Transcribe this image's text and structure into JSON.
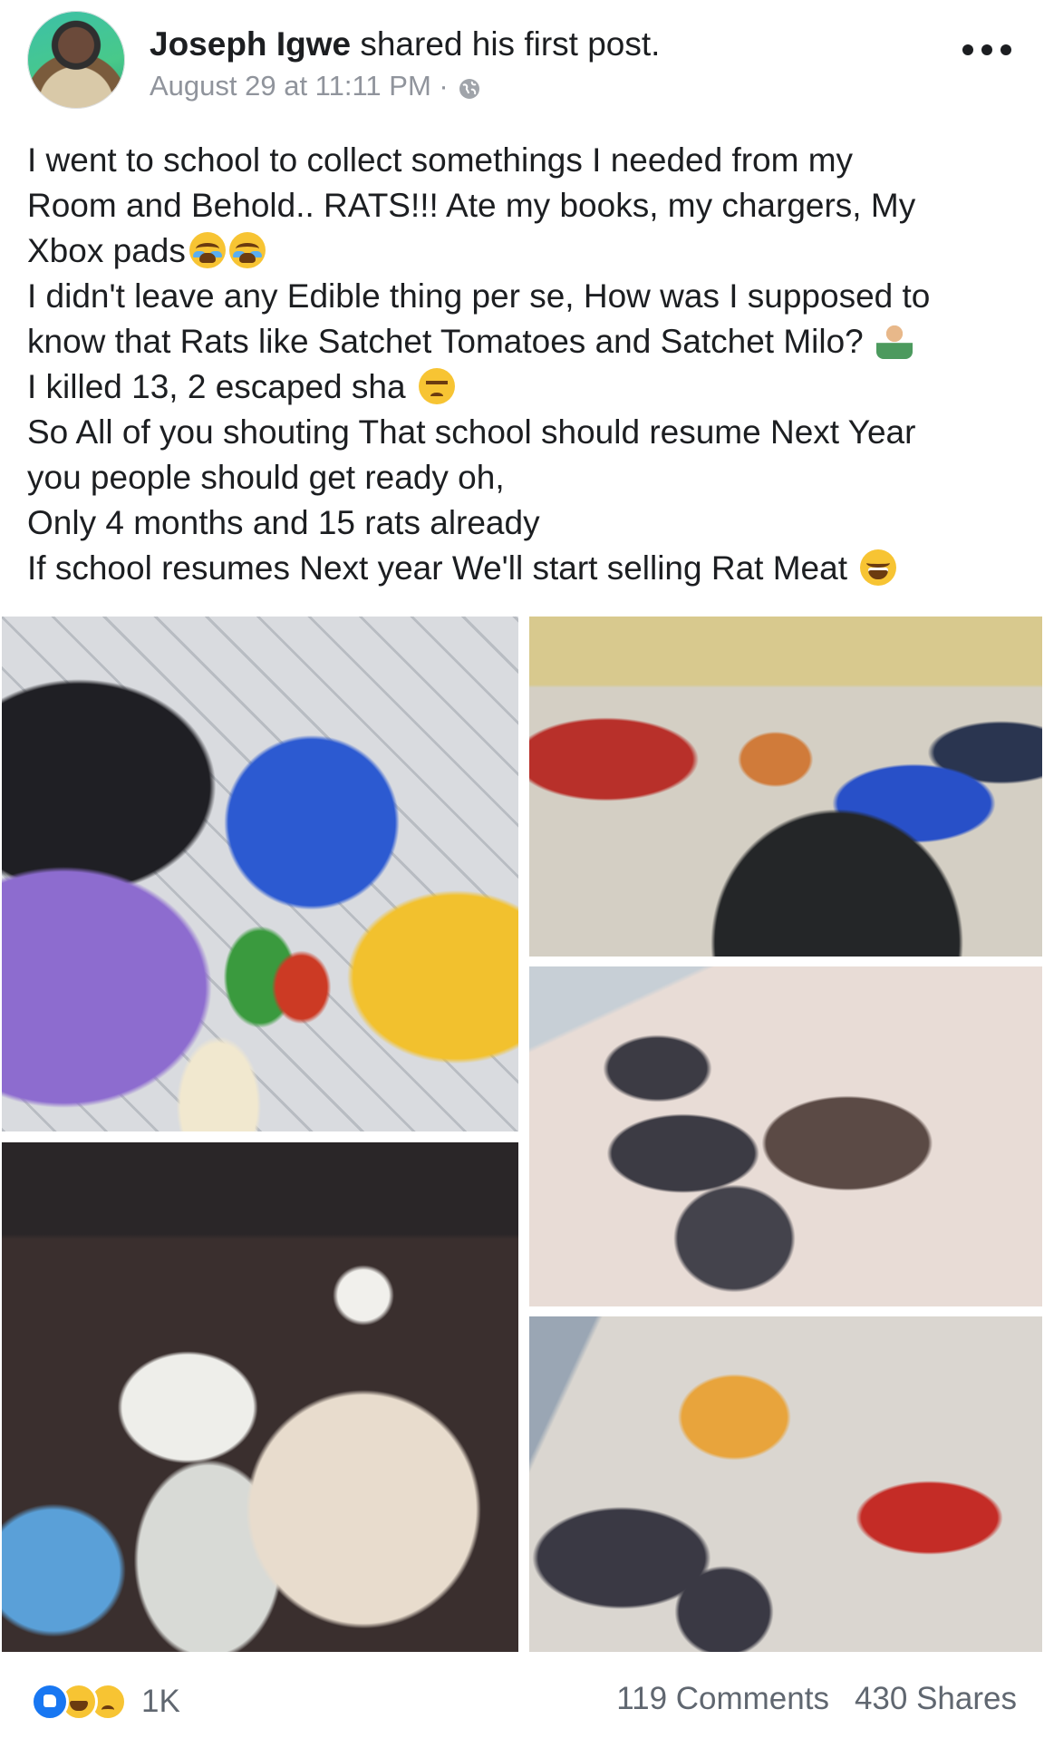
{
  "post": {
    "author": "Joseph Igwe",
    "action": "shared his first post.",
    "date": "August 29 at 11:11 PM",
    "separator": "·",
    "privacy_icon": "globe-icon",
    "more_icon": "more-options-icon",
    "lines": [
      "I went to school to collect somethings I needed from my",
      "Room and Behold.. RATS!!! Ate my books, my chargers, My",
      "Xbox pads",
      "I didn't leave any Edible thing per se, How was I supposed to",
      "know that Rats like Satchet Tomatoes and Satchet Milo?",
      "I killed 13, 2 escaped sha",
      "So All of you shouting That school should resume Next Year",
      "you people should get ready oh,",
      "Only 4 months and 15 rats already",
      "If school resumes Next year We'll start selling Rat Meat"
    ],
    "emojis": [
      "crying-face",
      "crying-face",
      "man-shrugging",
      "unamused-face",
      "laughing-face"
    ]
  },
  "photos": [
    {
      "subject": "cornered bags with chewed Milo sachets"
    },
    {
      "subject": "scattered clothes and bags on floor"
    },
    {
      "subject": "pile of dead rats on tiled floor"
    },
    {
      "subject": "chewed papers and Xbox controller in bag"
    },
    {
      "subject": "dead rats next to chewed tomato sachets"
    }
  ],
  "footer": {
    "reaction_icons": [
      "like-icon",
      "haha-icon",
      "sad-icon"
    ],
    "reaction_count": "1K",
    "comments": "119 Comments",
    "shares": "430 Shares"
  },
  "colors": {
    "text": "#1c1e21",
    "meta": "#90949c",
    "like_blue": "#1877f2",
    "emoji_yellow": "#f7c433"
  }
}
